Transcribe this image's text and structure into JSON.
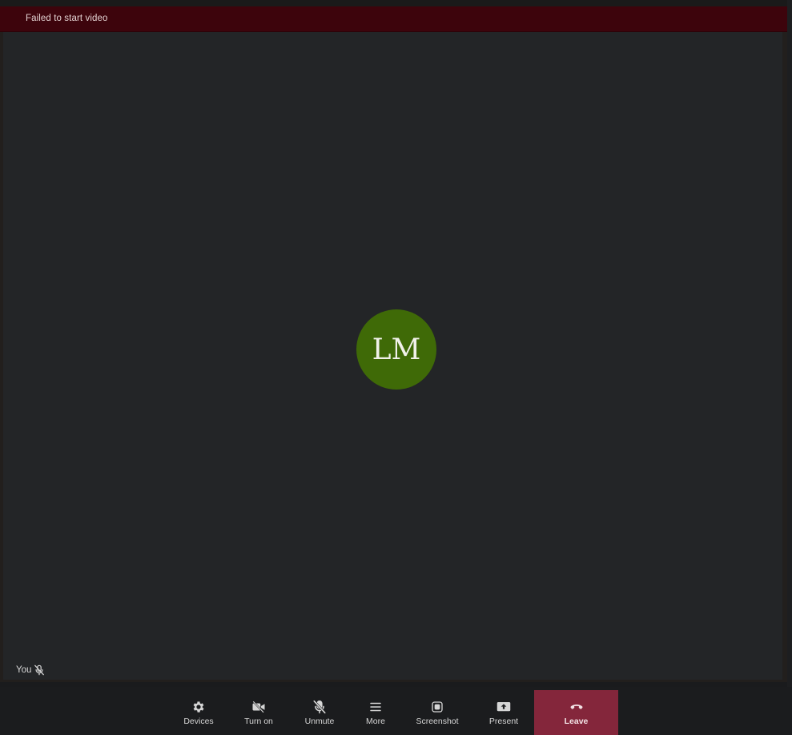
{
  "error_banner": {
    "text": "Failed to start video"
  },
  "participant": {
    "initials": "LM",
    "avatar_color": "#3f6a07",
    "name": "You",
    "muted_icon": "mic-off-icon"
  },
  "toolbar": {
    "devices": {
      "label": "Devices",
      "icon": "gear-icon"
    },
    "camera": {
      "label": "Turn on",
      "icon": "camera-off-icon"
    },
    "mic": {
      "label": "Unmute",
      "icon": "mic-off-icon"
    },
    "more": {
      "label": "More",
      "icon": "menu-icon"
    },
    "screenshot": {
      "label": "Screenshot",
      "icon": "screenshot-icon"
    },
    "present": {
      "label": "Present",
      "icon": "present-icon"
    },
    "leave": {
      "label": "Leave",
      "icon": "hangup-icon",
      "color": "#84263b"
    }
  }
}
